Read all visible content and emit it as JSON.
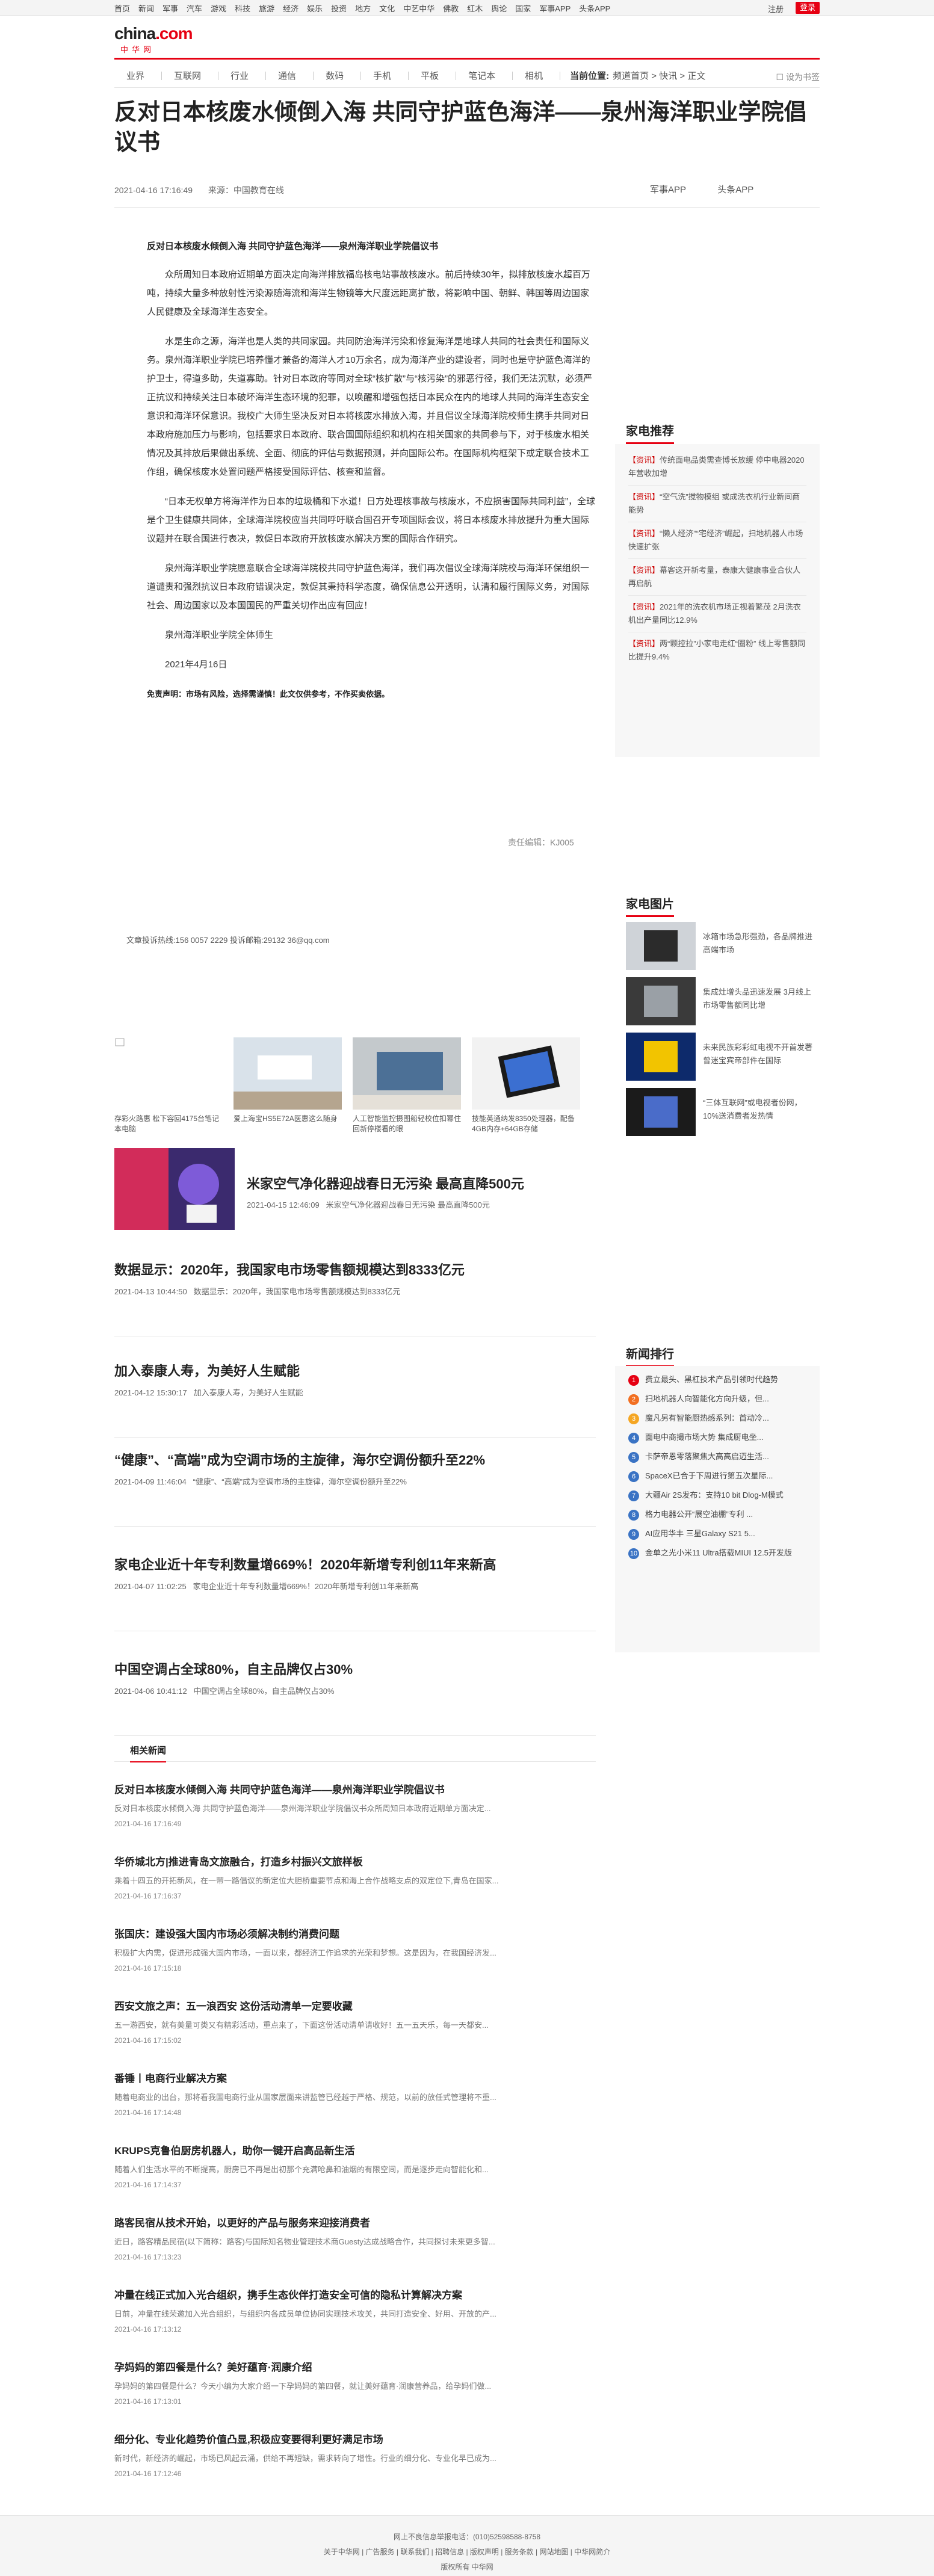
{
  "topbar": {
    "links": [
      "首页",
      "新闻",
      "军事",
      "汽车",
      "游戏",
      "科技",
      "旅游",
      "经济",
      "娱乐",
      "投资",
      "地方",
      "文化",
      "中艺中华",
      "佛教",
      "红木",
      "舆论",
      "国家",
      "军事APP",
      "头条APP"
    ],
    "login": "注册",
    "register": "登录"
  },
  "logo": {
    "main_a": "china",
    "main_b": ".com",
    "sub": "中华网"
  },
  "nav": {
    "items": [
      "业界",
      "互联网",
      "行业",
      "通信",
      "数码",
      "手机",
      "平板",
      "笔记本",
      "相机"
    ],
    "loc_label": "当前位置:",
    "crumb": "频道首页 > 快讯 > 正文",
    "collect": "设为书签"
  },
  "article": {
    "title": "反对日本核废水倾倒入海 共同守护蓝色海洋——泉州海洋职业学院倡议书",
    "time": "2021-04-16 17:16:49",
    "source": "来源：中国教育在线",
    "app1": "军事APP",
    "app2": "头条APP",
    "lead": "反对日本核废水倾倒入海 共同守护蓝色海洋——泉州海洋职业学院倡议书",
    "p1": "众所周知日本政府近期单方面决定向海洋排放福岛核电站事故核废水。前后持续30年，拟排放核废水超百万吨，持续大量多种放射性污染源随海流和海洋生物镜等大尺度远距离扩散，将影响中国、朝鲜、韩国等周边国家人民健康及全球海洋生态安全。",
    "p2": "水是生命之源，海洋也是人类的共同家园。共同防治海洋污染和修复海洋是地球人共同的社会责任和国际义务。泉州海洋职业学院已培养懂才兼备的海洋人才10万余名，成为海洋产业的建设者，同时也是守护蓝色海洋的护卫士，得道多助，失道寡助。针对日本政府等同对全球“核扩散”与“核污染”的邪恶行径，我们无法沉默，必须严正抗议和持续关注日本破坏海洋生态环境的犯罪，以唤醒和增强包括日本民众在内的地球人共同的海洋生态安全意识和海洋环保意识。我校广大师生坚决反对日本将核废水排放入海，并且倡议全球海洋院校师生携手共同对日本政府施加压力与影响，包括要求日本政府、联合国国际组织和机构在相关国家的共同参与下，对于核废水相关情况及其排放后果做出系统、全面、彻底的评估与数据预测，并向国际公布。在国际机构框架下或定联合技术工作组，确保核废水处置问题严格接受国际评估、核查和监督。",
    "p3": "“日本无权单方将海洋作为日本的垃圾桶和下水道！日方处理核事故与核废水，不应损害国际共同利益”，全球是个卫生健康共同体，全球海洋院校应当共同呼吁联合国召开专项国际会议，将日本核废水排放提升为重大国际议题并在联合国进行表决，敦促日本政府开放核废水解决方案的国际合作研究。",
    "p4": "泉州海洋职业学院愿意联合全球海洋院校共同守护蓝色海洋，我们再次倡议全球海洋院校与海洋环保组织一道谴责和强烈抗议日本政府错误决定，敦促其秉持科学态度，确保信息公开透明，认清和履行国际义务，对国际社会、周边国家以及本国国民的严重关切作出应有回应！",
    "p5": "泉州海洋职业学院全体师生",
    "p6": "2021年4月16日",
    "disclaimer": "免责声明：市场有风险，选择需谨慎！此文仅供参考，不作买卖依据。",
    "editor": "责任编辑：KJ005"
  },
  "contact": "文章投诉热线:156 0057 2229 投诉邮箱:29132 36@qq.com",
  "sidebar": {
    "rec_title": "家电推荐",
    "rec_items": [
      {
        "tag": "【资讯】",
        "text": "传统面电品类需查博长放缓 停中电器2020年营收加增"
      },
      {
        "tag": "【资讯】",
        "text": "“空气洗”搅物模组 或成洗衣机行业新间商能势"
      },
      {
        "tag": "【资讯】",
        "text": "“懒人经济”“宅经济”崛起，扫地机器人市场快速扩张"
      },
      {
        "tag": "【资讯】",
        "text": "幕客这开新考量，泰康大健康事业合伙人再启航"
      },
      {
        "tag": "【资讯】",
        "text": "2021年的洗衣机市场正视着繁茂 2月洗衣机出产量同比12.9%"
      },
      {
        "tag": "【资讯】",
        "text": "两“颗控拉”小家电走红“圈粉” 线上零售额同比提升9.4%"
      }
    ],
    "pic_title": "家电图片",
    "pic_items": [
      "冰箱市场急形强劲，各品牌推进高端市场",
      "集成灶增头品迅速发展 3月线上市场零售额同比增",
      "未来民族彩彩虹电视不开首发著 曾迷宝宾帝部件在国际",
      "“三体互联网”或电视者份网，10%送消费者发热情"
    ],
    "rank_title": "新闻排行",
    "rank_items": [
      "费立最头、黑杠技术产品引领时代趋势",
      "扫地机器人向智能化方向升级，但...",
      "魔凡另有智能厨热感系列：首动冷...",
      "面电中商撮市场大势 集成厨电坐...",
      "卡萨帝恩零落聚焦大高高启迈生活...",
      "SpaceX已合于下周进行第五次星际...",
      "大疆Air 2S发布：支持10 bit Dlog-M模式",
      "格力电器公开“展空油棚”专利 ...",
      "AI应用华丰 三星Galaxy S21 5...",
      "金单之光小米11 Ultra搭载MIUI 12.5开发版"
    ]
  },
  "thumbs": [
    {
      "alt": "存彩火路惠 松下容回4175台笔记本电脑",
      "cap": "存彩火路惠 松下容回4175台笔记本电脑"
    },
    {
      "alt": "",
      "cap": "爱上海宝HS5E72A医惠这么随身"
    },
    {
      "alt": "",
      "cap": "人工智能监控摄图船轻校位扣幂住回新停楼看的眼"
    },
    {
      "alt": "",
      "cap": "技能英通纳发8350处理器，配备4GB内存+64GB存储"
    }
  ],
  "big_news": {
    "title": "米家空气净化器迎战春日无污染 最高直降500元",
    "time": "2021-04-15 12:46:09",
    "summary": "米家空气净化器迎战春日无污染 最高直降500元"
  },
  "news": [
    {
      "title": "数据显示：2020年，我国家电市场零售额规模达到8333亿元",
      "time": "2021-04-13 10:44:50",
      "summary": "数据显示：2020年，我国家电市场零售额规模达到8333亿元"
    },
    {
      "title": "加入泰康人寿，为美好人生赋能",
      "time": "2021-04-12 15:30:17",
      "summary": "加入泰康人寿，为美好人生赋能"
    },
    {
      "title": "“健康”、“高端”成为空调市场的主旋律，海尔空调份额升至22%",
      "time": "2021-04-09 11:46:04",
      "summary": "“健康”、“高端”成为空调市场的主旋律，海尔空调份额升至22%"
    },
    {
      "title": "家电企业近十年专利数量增669%！2020年新增专利创11年来新高",
      "time": "2021-04-07 11:02:25",
      "summary": "家电企业近十年专利数量增669%！2020年新增专利创11年来新高"
    },
    {
      "title": "中国空调占全球80%，自主品牌仅占30%",
      "time": "2021-04-06 10:41:12",
      "summary": "中国空调占全球80%，自主品牌仅占30%"
    }
  ],
  "related": {
    "head": "相关新闻",
    "items": [
      {
        "title": "反对日本核废水倾倒入海 共同守护蓝色海洋——泉州海洋职业学院倡议书",
        "summary": "反对日本核废水倾倒入海 共同守护蓝色海洋——泉州海洋职业学院倡议书众所周知日本政府近期单方面决定...",
        "time": "2021-04-16 17:16:49"
      },
      {
        "title": "华侨城北方|推进青岛文旅融合，打造乡村振兴文旅样板",
        "summary": "乘着十四五的开拓新风，在一带一路倡议的新定位大胆桥重要节点和海上合作战略支点的双定位下,青岛在国家...",
        "time": "2021-04-16 17:16:37"
      },
      {
        "title": "张国庆：建设强大国内市场必须解决制约消费问题",
        "summary": "积极扩大内需，促进形成强大国内市场，一面以来，都经济工作追求的光荣和梦想。这是因为，在我国经济发...",
        "time": "2021-04-16 17:15:18"
      },
      {
        "title": "西安文旅之声：五一浪西安 这份活动清单一定要收藏",
        "summary": "五一游西安，就有美量可类又有精彩活动，重点来了，下面这份活动清单请收好！五一五天乐，每一天都安...",
        "time": "2021-04-16 17:15:02"
      },
      {
        "title": "番锤丨电商行业解决方案",
        "summary": "随着电商业的出台，那将看我国电商行业从国家层面来讲监管已经越于严格、规范，以前的放任式管理将不重...",
        "time": "2021-04-16 17:14:48"
      },
      {
        "title": "KRUPS克鲁伯厨房机器人，助你一键开启高品新生活",
        "summary": "随着人们生活水平的不断提高，厨房已不再是出初那个充满呛鼻和油烟的有限空间，而是逐步走向智能化和...",
        "time": "2021-04-16 17:14:37"
      },
      {
        "title": "路客民宿从技术开始，以更好的产品与服务来迎接消费者",
        "summary": "近日，路客精品民宿(以下简称：路客)与国际知名物业管理技术商Guesty达成战略合作，共同探讨未来更多智...",
        "time": "2021-04-16 17:13:23"
      },
      {
        "title": "冲量在线正式加入光合组织，携手生态伙伴打造安全可信的隐私计算解决方案",
        "summary": "日前，冲量在线荣邀加入光合组织，与组织内各成员单位协同实现技术攻关，共同打造安全、好用、开放的产...",
        "time": "2021-04-16 17:13:12"
      },
      {
        "title": "孕妈妈的第四餐是什么？美好蕴育·润康介绍",
        "summary": "孕妈妈的第四餐是什么？今天小编为大家介绍一下孕妈妈的第四餐，就让美好蕴育·润康营养品，给孕妈们做...",
        "time": "2021-04-16 17:13:01"
      },
      {
        "title": "细分化、专业化趋势价值凸显,积极应变要得利更好满足市场",
        "summary": "新时代，新经济的崛起，市场已风起云涌，供给不再短缺，需求转向了增性。行业的细分化、专业化早已成为...",
        "time": "2021-04-16 17:12:46"
      }
    ]
  },
  "footer": {
    "l1": "网上不良信息举报电话：(010)52598588-8758",
    "l2": "关于中华网 | 广告服务 | 联系我们 | 招聘信息 | 版权声明 | 服务条款 | 网站地图 | 中华网简介",
    "l3": "版权所有 中华网"
  },
  "colors": {
    "brand": "#e60012",
    "text": "#333333",
    "muted": "#888888"
  }
}
